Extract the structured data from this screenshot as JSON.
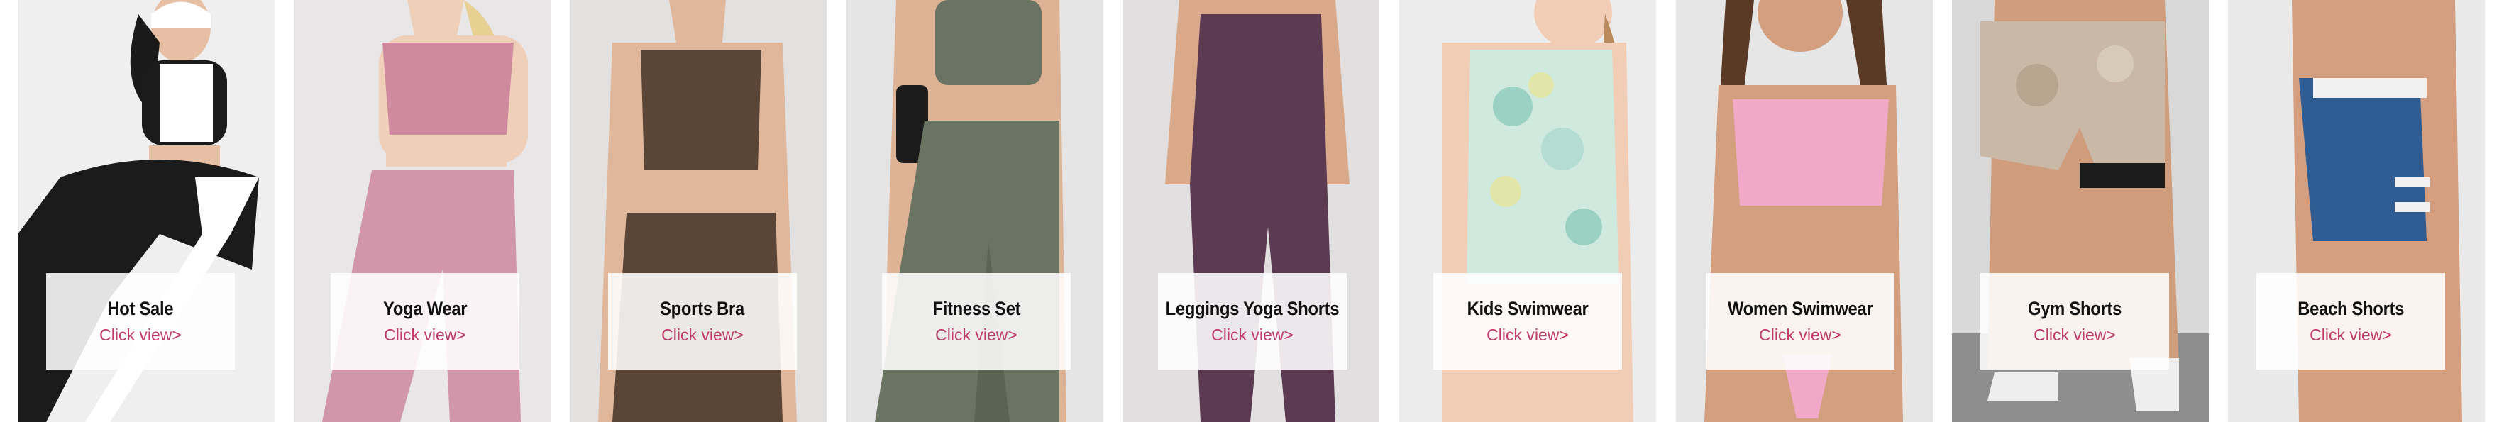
{
  "categories": [
    {
      "title": "Hot Sale",
      "link": "Click view>",
      "bg": "#ececec",
      "accent": "#1b1b1b",
      "skin": "#e6bfa4"
    },
    {
      "title": "Yoga Wear",
      "link": "Click view>",
      "bg": "#e8e6e7",
      "accent": "#cf8aa0",
      "skin": "#efcfb8"
    },
    {
      "title": "Sports Bra",
      "link": "Click view>",
      "bg": "#e3e1df",
      "accent": "#5a4536",
      "skin": "#e0b79b"
    },
    {
      "title": "Fitness Set",
      "link": "Click view>",
      "bg": "#e4e4e4",
      "accent": "#6b7462",
      "skin": "#deb294"
    },
    {
      "title": "Leggings Yoga Shorts",
      "link": "Click view>",
      "bg": "#e1dfe0",
      "accent": "#5b3a52",
      "skin": "#d9a98a"
    },
    {
      "title": "Kids Swimwear",
      "link": "Click view>",
      "bg": "#ececec",
      "accent": "#a6d7c8",
      "skin": "#f1cdb6"
    },
    {
      "title": "Women Swimwear",
      "link": "Click view>",
      "bg": "#e6e6e6",
      "accent": "#f1a9c8",
      "skin": "#d49f7f"
    },
    {
      "title": "Gym Shorts",
      "link": "Click view>",
      "bg": "#d8d8d8",
      "accent": "#c9b8a6",
      "skin": "#cf9c7c"
    },
    {
      "title": "Beach Shorts",
      "link": "Click view>",
      "bg": "#e9e9e9",
      "accent": "#2f5d93",
      "skin": "#d59e7e"
    }
  ]
}
